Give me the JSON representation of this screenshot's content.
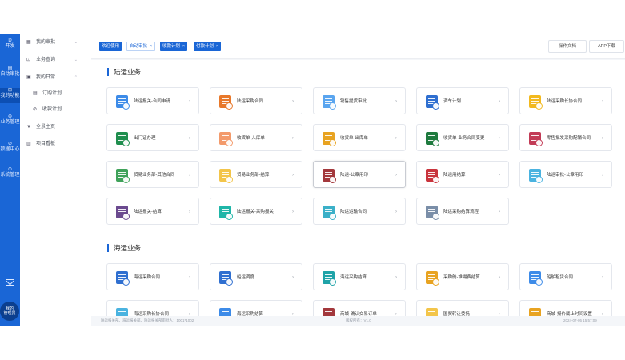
{
  "rail": {
    "items": [
      {
        "label": "开发",
        "glyph": "D"
      },
      {
        "label": "自动审批",
        "glyph": "▤"
      },
      {
        "label": "我的功能",
        "glyph": "⊞"
      },
      {
        "label": "业务管理",
        "glyph": "⊕"
      },
      {
        "label": "数据中心",
        "glyph": "⊘"
      },
      {
        "label": "系统管理",
        "glyph": "⊙"
      }
    ],
    "avatar_line1": "我的",
    "avatar_line2": "管理员"
  },
  "submenu": {
    "items": [
      {
        "icon": "▦",
        "label": "我的审批",
        "arrow": "⌄"
      },
      {
        "icon": "⊡",
        "label": "业务查询",
        "arrow": "⌄"
      },
      {
        "icon": "▣",
        "label": "我的日常",
        "arrow": "⌃"
      },
      {
        "icon": "▤",
        "label": "订购计划",
        "arrow": ""
      },
      {
        "icon": "⊘",
        "label": "收款计划",
        "arrow": ""
      },
      {
        "icon": "▼",
        "label": "全景主页",
        "arrow": ""
      },
      {
        "icon": "▥",
        "label": "项目看板",
        "arrow": ""
      }
    ]
  },
  "tabs": [
    {
      "label": "欢迎使用",
      "closable": false,
      "active": true
    },
    {
      "label": "自动审批",
      "closable": true,
      "active": false
    },
    {
      "label": "收款计划",
      "closable": true,
      "active": true
    },
    {
      "label": "付款计划",
      "closable": true,
      "active": true
    }
  ],
  "header": {
    "download_doc": "操作文档",
    "download_app": "APP下载"
  },
  "sections": [
    {
      "title": "陆运业务",
      "cards": [
        {
          "label": "陆运报关-合同申请",
          "color": "#3d8be8"
        },
        {
          "label": "陆运采购合同",
          "color": "#e8782a"
        },
        {
          "label": "销售提货审批",
          "color": "#5aa5ef"
        },
        {
          "label": "调车计划",
          "color": "#2f6fd0"
        },
        {
          "label": "陆运采购长协合同",
          "color": "#f2b91e"
        },
        {
          "label": "出门证办理",
          "color": "#1f8e4e"
        },
        {
          "label": "收货单-入库单",
          "color": "#f39a6b"
        },
        {
          "label": "收货单-出库单",
          "color": "#e8a321"
        },
        {
          "label": "收货单-业务合同变更",
          "color": "#1e7a3e"
        },
        {
          "label": "零售批发采购配销合同",
          "color": "#c23b56"
        },
        {
          "label": "贸易业务部-其他合同",
          "color": "#3fa25a"
        },
        {
          "label": "贸易业务部-结算",
          "color": "#f3c54a"
        },
        {
          "label": "陆运-公章用印",
          "color": "#a3383c"
        },
        {
          "label": "陆运用结算",
          "color": "#c9343d"
        },
        {
          "label": "陆运审批-公章用印",
          "color": "#4ab3e0"
        },
        {
          "label": "陆运报关-结算",
          "color": "#6b4a8f"
        },
        {
          "label": "陆运报关-采购报关",
          "color": "#1fb6a8"
        },
        {
          "label": "陆运运输合同",
          "color": "#3bb0c8"
        },
        {
          "label": "陆运采购结算流程",
          "color": "#7a8ea8"
        }
      ]
    },
    {
      "title": "海运业务",
      "cards": [
        {
          "label": "海运采购合同",
          "color": "#2f6fd0"
        },
        {
          "label": "船运调度",
          "color": "#2f6fd0"
        },
        {
          "label": "海运采购结算",
          "color": "#1fa3a8"
        },
        {
          "label": "采购舱-堆場费结算",
          "color": "#e8a321"
        },
        {
          "label": "船舶租赁合同",
          "color": "#3d8be8"
        },
        {
          "label": "海运采购长协合同",
          "color": "#4ab3e0"
        },
        {
          "label": "海运采购结算",
          "color": "#3d8be8"
        },
        {
          "label": "商城-确认交易订单",
          "color": "#a3383c"
        },
        {
          "label": "国贸转让委托",
          "color": "#f3c54a"
        },
        {
          "label": "商城-报价截止时间设置",
          "color": "#e8a321"
        }
      ]
    }
  ],
  "footer": {
    "left": "陆运报关部、海运报关部、陆运报关部审批人：1001*1002",
    "center": "版权所有：V1.0",
    "right": "2024-07-05 15:57:09"
  }
}
